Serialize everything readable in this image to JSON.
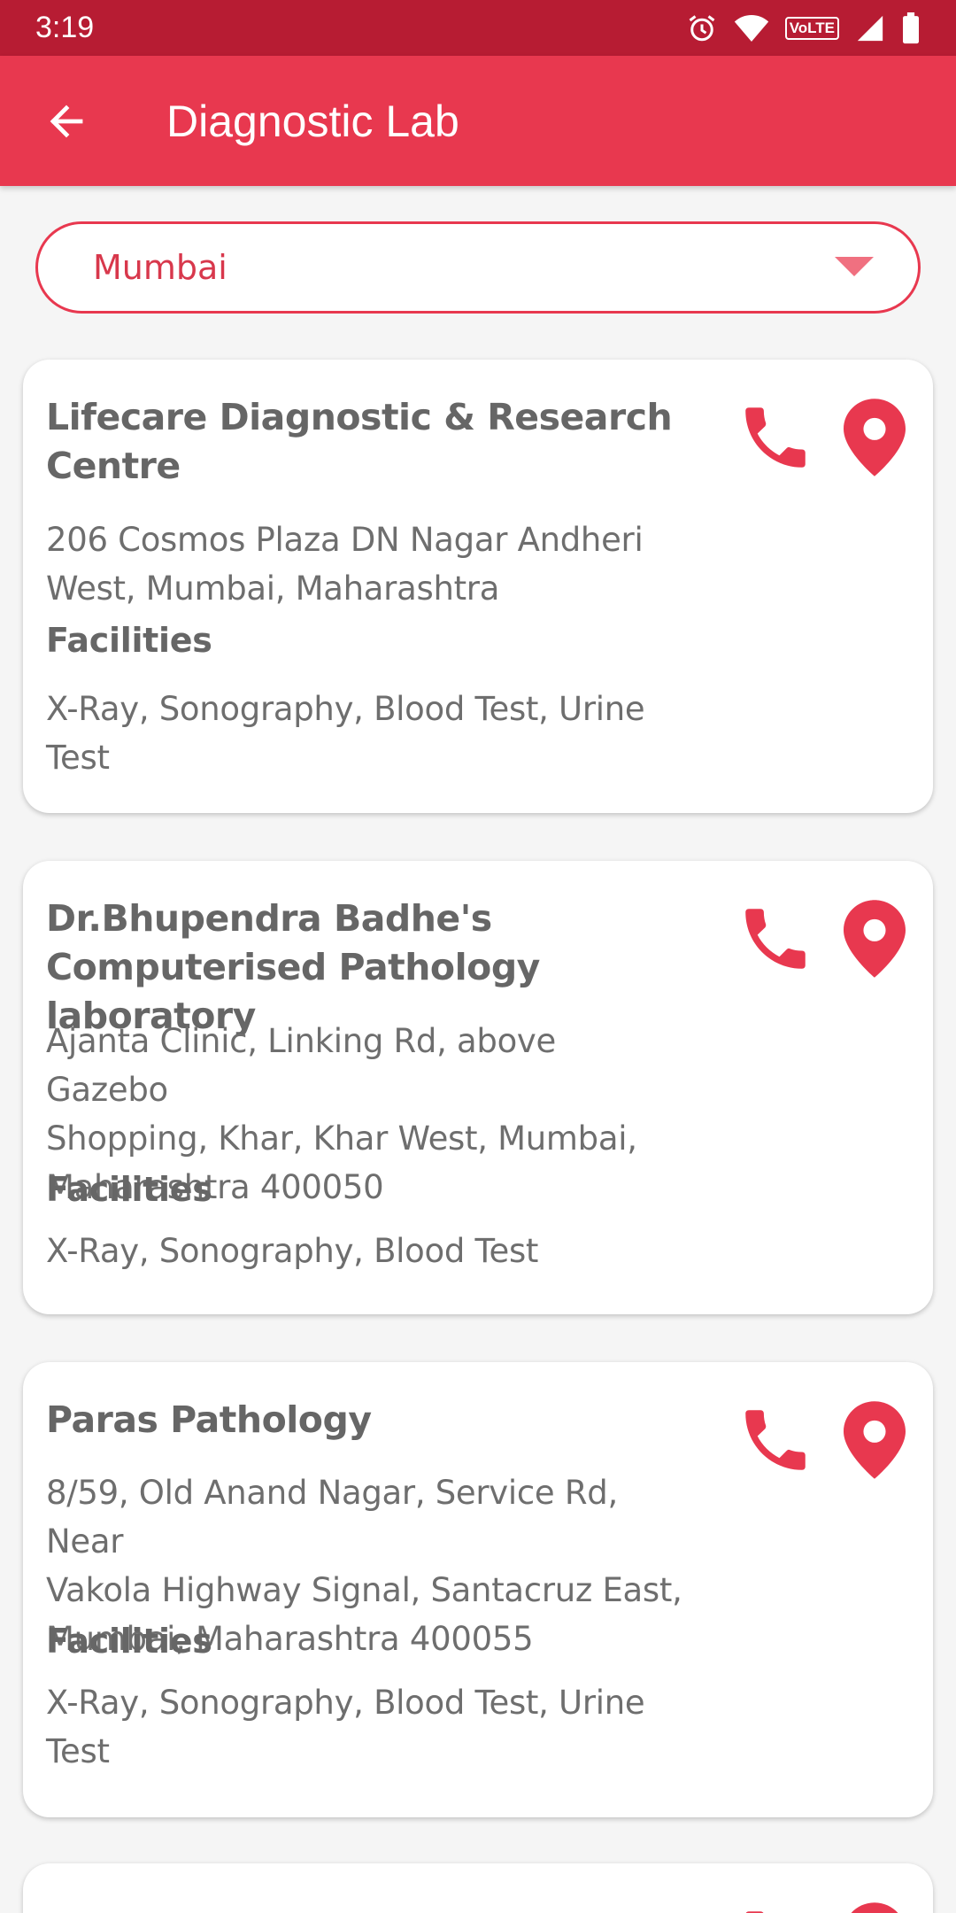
{
  "status_bar": {
    "time": "3:19",
    "network_badge": "VoLTE",
    "icons": [
      "alarm-icon",
      "wifi-icon",
      "volte-icon",
      "signal-icon",
      "battery-icon"
    ]
  },
  "app_bar": {
    "title": "Diagnostic Lab",
    "back_icon": "arrow-left-icon"
  },
  "city_select": {
    "value": "Mumbai",
    "icon": "triangle-down-icon"
  },
  "facilities_label": "Facilities",
  "labs": [
    {
      "name_lines": [
        "Lifecare Diagnostic & Research",
        "Centre"
      ],
      "address_lines": [
        "206 Cosmos Plaza DN Nagar Andheri",
        "West, Mumbai, Maharashtra"
      ],
      "facilities_lines": [
        "X-Ray, Sonography, Blood Test, Urine",
        "Test"
      ]
    },
    {
      "name_lines": [
        "Dr.Bhupendra Badhe's",
        "Computerised Pathology laboratory"
      ],
      "address_lines": [
        "Ajanta Clinic, Linking Rd, above Gazebo",
        "Shopping, Khar, Khar West, Mumbai,",
        "Maharashtra 400050"
      ],
      "facilities_lines": [
        "X-Ray, Sonography, Blood Test"
      ]
    },
    {
      "name_lines": [
        "Paras Pathology"
      ],
      "address_lines": [
        "8/59, Old Anand Nagar, Service Rd, Near",
        "Vakola Highway Signal, Santacruz East,",
        "Mumbai, Maharashtra 400055"
      ],
      "facilities_lines": [
        "X-Ray, Sonography, Blood Test, Urine",
        "Test"
      ]
    }
  ],
  "colors": {
    "status_bar": "#b71c33",
    "primary": "#e8384f",
    "background": "#f5f5f5",
    "card": "#ffffff",
    "text": "#6e6e6e"
  }
}
